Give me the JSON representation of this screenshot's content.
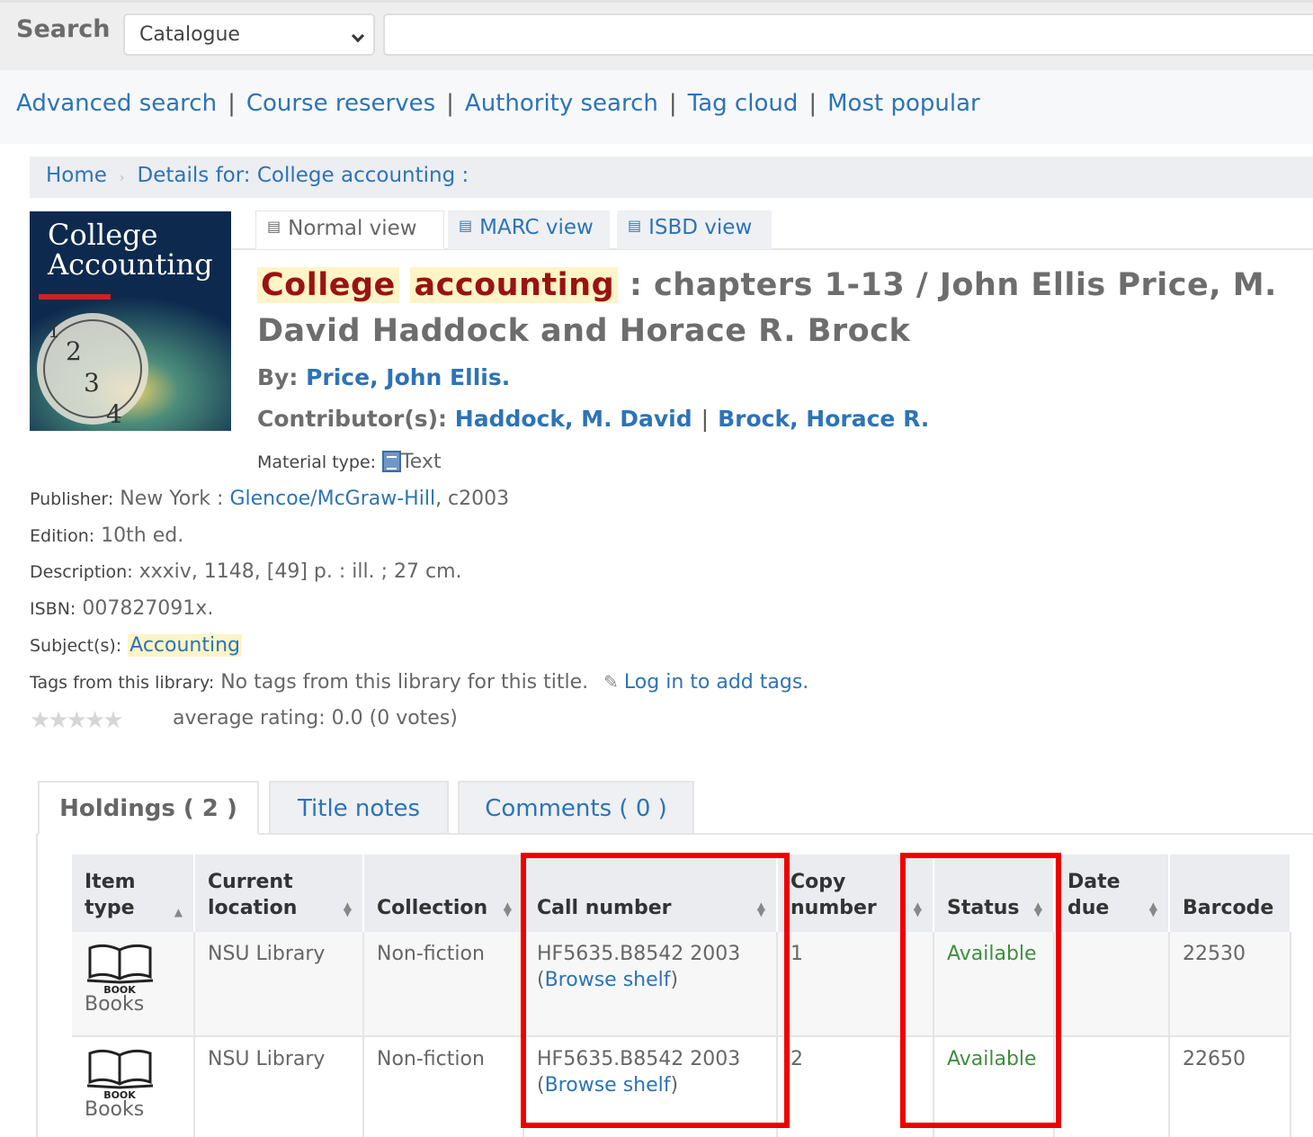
{
  "search": {
    "label": "Search",
    "scope_value": "Catalogue",
    "query_value": ""
  },
  "nav": {
    "links": [
      "Advanced search",
      "Course reserves",
      "Authority search",
      "Tag cloud",
      "Most popular"
    ],
    "separator": "|"
  },
  "breadcrumb": {
    "home": "Home",
    "current": "Details for: College accounting :"
  },
  "view_tabs": {
    "normal": "Normal view",
    "marc": "MARC view",
    "isbd": "ISBD view"
  },
  "record": {
    "title_hl1": "College",
    "title_hl2": "accounting",
    "title_rest": ": chapters 1-13 / John Ellis Price, M. David Haddock and Horace R. Brock",
    "by_label": "By:",
    "author": "Price, John Ellis.",
    "contrib_label": "Contributor(s):",
    "contrib1": "Haddock, M. David",
    "contrib2": "Brock, Horace R.",
    "material_label": "Material type:",
    "material_value": "Text",
    "publisher_label": "Publisher:",
    "publisher_place": "New York :",
    "publisher_name": "Glencoe/McGraw-Hill",
    "publisher_date": ", c2003",
    "edition_label": "Edition:",
    "edition_value": "10th ed.",
    "description_label": "Description:",
    "description_value": "xxxiv, 1148, [49] p. : ill. ; 27 cm.",
    "isbn_label": "ISBN:",
    "isbn_value": "007827091x.",
    "subjects_label": "Subject(s):",
    "subject_value": "Accounting",
    "tags_label": "Tags from this library:",
    "tags_value": "No tags from this library for this title.",
    "tags_login": "Log in to add tags.",
    "rating_text": "average rating: 0.0 (0 votes)",
    "rating_value": 0
  },
  "cover": {
    "line1": "College",
    "line2": "Accounting"
  },
  "holding_tabs": {
    "holdings": "Holdings ( 2 )",
    "notes": "Title notes",
    "comments": "Comments ( 0 )"
  },
  "table": {
    "headers": {
      "item_type_1": "Item",
      "item_type_2": "type",
      "location_1": "Current",
      "location_2": "location",
      "collection": "Collection",
      "call_number": "Call number",
      "copy_1": "Copy",
      "copy_2": "number",
      "status": "Status",
      "due_1": "Date",
      "due_2": "due",
      "barcode": "Barcode"
    },
    "rows": [
      {
        "icon_label": "BOOK",
        "item_type": "Books",
        "location": "NSU Library",
        "collection": "Non-fiction",
        "call_number": "HF5635.B8542 2003",
        "browse_open": "(",
        "browse": "Browse shelf",
        "browse_close": ")",
        "copy": "1",
        "status": "Available",
        "date_due": "",
        "barcode": "22530"
      },
      {
        "icon_label": "BOOK",
        "item_type": "Books",
        "location": "NSU Library",
        "collection": "Non-fiction",
        "call_number": "HF5635.B8542 2003",
        "browse_open": "(",
        "browse": "Browse shelf",
        "browse_close": ")",
        "copy": "2",
        "status": "Available",
        "date_due": "",
        "barcode": "22650"
      }
    ]
  },
  "colors": {
    "link": "#2d73b6",
    "highlight_bg": "#fdf4c7",
    "highlight_text": "#9a1212",
    "available": "#3e8e3e",
    "annotation_box": "#ee0000"
  }
}
